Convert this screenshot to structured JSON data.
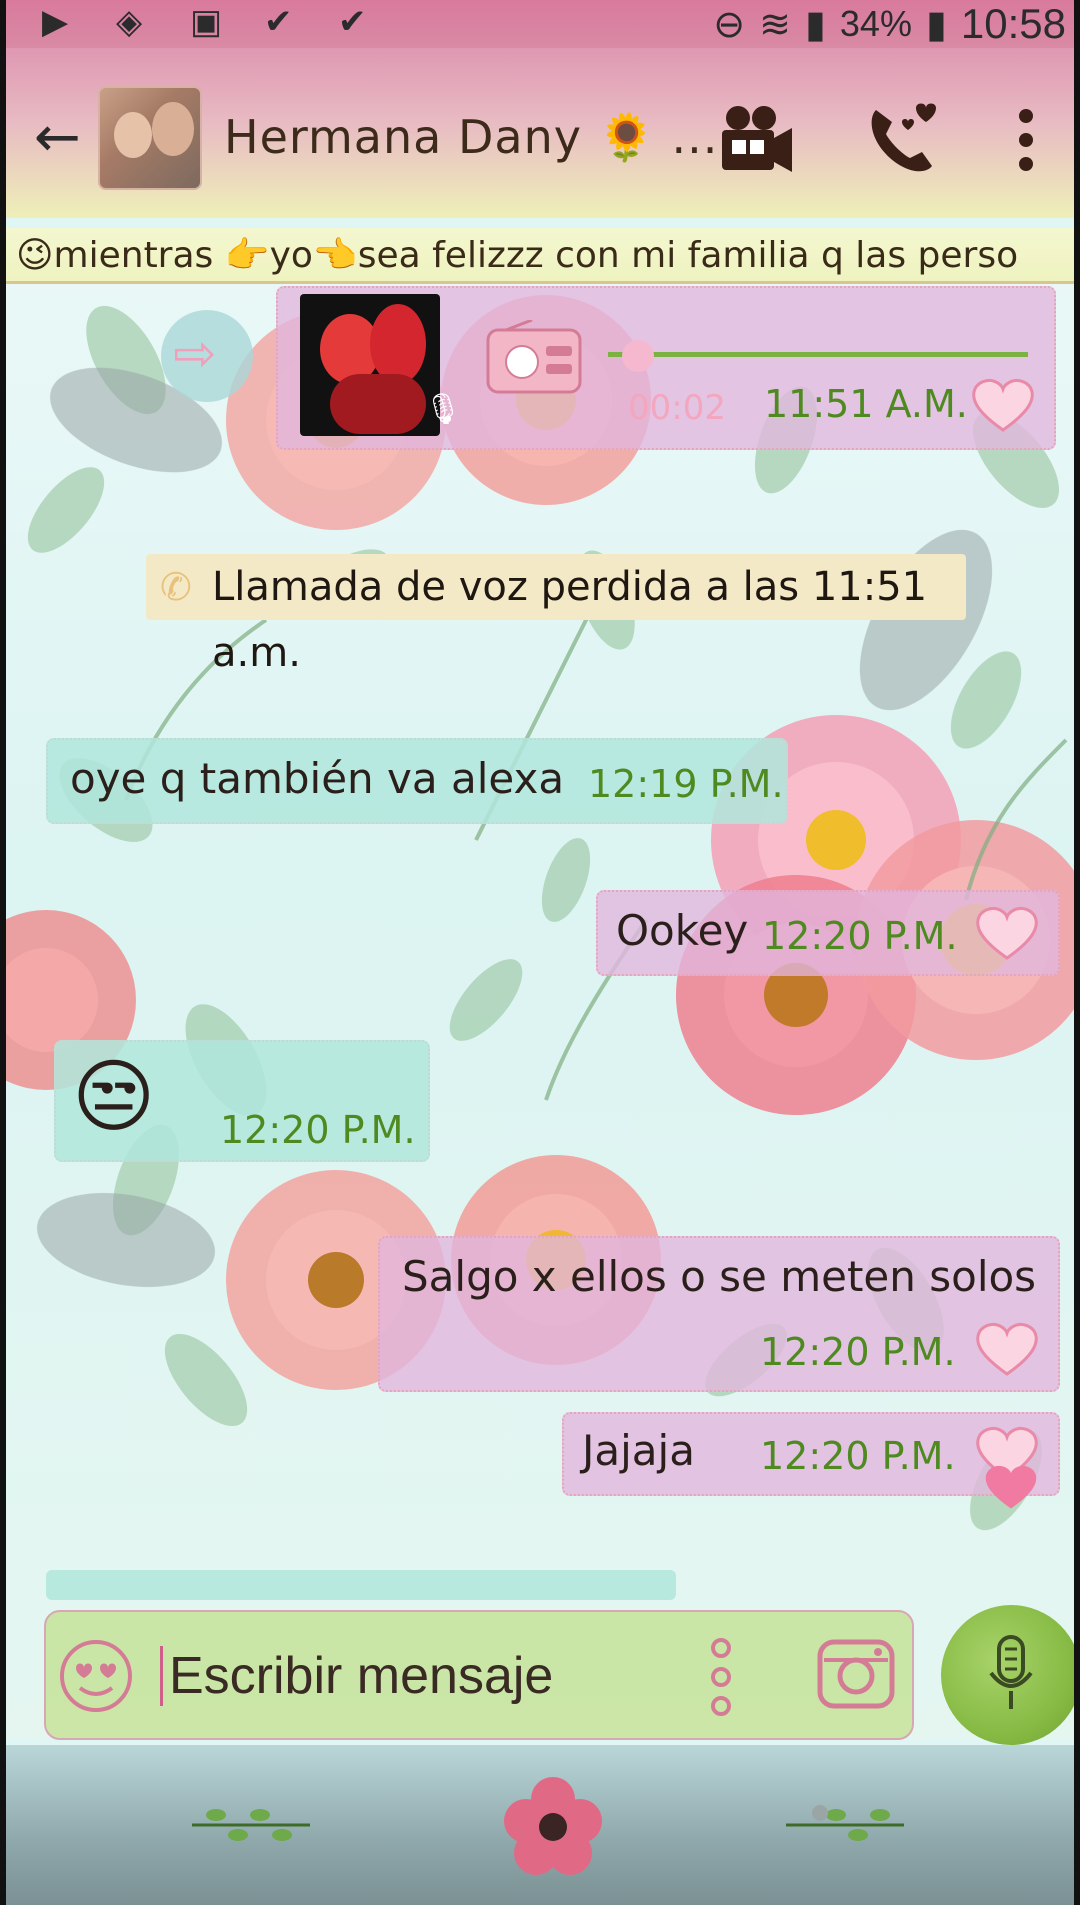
{
  "status_bar": {
    "battery_percent": "34%",
    "time": "10:58"
  },
  "header": {
    "contact_name": "Hermana Dany 🌻 ...",
    "back_icon": "arrow-back-icon",
    "video_call_icon": "video-camera-icon",
    "voice_call_icon": "phone-heart-icon",
    "menu_icon": "more-vertical-icon"
  },
  "marquee": {
    "text": "😉mientras 👉yo👈sea felizzz con mi familia q las perso"
  },
  "messages": {
    "voice_note": {
      "duration": "00:02",
      "time": "11:51 A.M."
    },
    "missed_call": "Llamada de voz perdida a las 11:51 a.m.",
    "m1": {
      "text": "oye q también va alexa",
      "time": "12:19 P.M."
    },
    "m2": {
      "text": "Ookey",
      "time": "12:20 P.M."
    },
    "m3": {
      "text": "😒",
      "time": "12:20 P.M."
    },
    "m4": {
      "text": "Salgo x ellos o se meten solos",
      "time": "12:20 P.M."
    },
    "m5": {
      "text": "Jajaja",
      "time": "12:20 P.M."
    }
  },
  "composer": {
    "placeholder": "Escribir mensaje",
    "emoji_icon": "heart-eyes-emoji-icon",
    "attach_icon": "more-vertical-dots-icon",
    "camera_icon": "camera-icon",
    "mic_icon": "microphone-icon"
  },
  "colors": {
    "outgoing_bubble": "#e2b6de",
    "incoming_bubble": "#b0e6dc",
    "timestamp": "#4f8a21",
    "header_top": "#df98b2",
    "header_bottom": "#eef0b8"
  }
}
